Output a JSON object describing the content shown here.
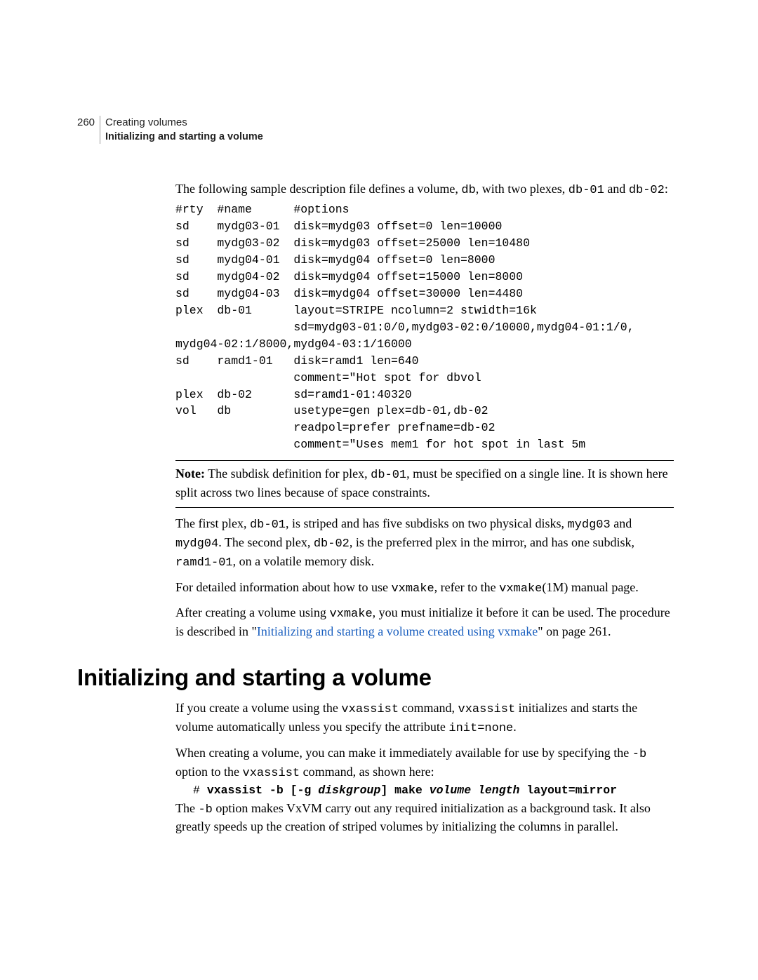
{
  "header": {
    "pagenum": "260",
    "chapter": "Creating volumes",
    "section": "Initializing and starting a volume"
  },
  "intro": {
    "pre": "The following sample description file defines a volume, ",
    "code1": "db",
    "mid1": ", with two plexes, ",
    "code2": "db-01",
    "mid2": " and ",
    "code3": "db-02",
    "end": ":"
  },
  "descfile": "#rty  #name      #options\nsd    mydg03-01  disk=mydg03 offset=0 len=10000\nsd    mydg03-02  disk=mydg03 offset=25000 len=10480\nsd    mydg04-01  disk=mydg04 offset=0 len=8000\nsd    mydg04-02  disk=mydg04 offset=15000 len=8000\nsd    mydg04-03  disk=mydg04 offset=30000 len=4480\nplex  db-01      layout=STRIPE ncolumn=2 stwidth=16k\n                 sd=mydg03-01:0/0,mydg03-02:0/10000,mydg04-01:1/0,\nmydg04-02:1/8000,mydg04-03:1/16000\nsd    ramd1-01   disk=ramd1 len=640\n                 comment=\"Hot spot for dbvol\nplex  db-02      sd=ramd1-01:40320\nvol   db         usetype=gen plex=db-01,db-02\n                 readpol=prefer prefname=db-02\n                 comment=\"Uses mem1 for hot spot in last 5m",
  "note": {
    "label": "Note:",
    "t1": " The subdisk definition for plex, ",
    "c1": "db-01",
    "t2": ", must be specified on a single line. It is shown here split across two lines because of space constraints."
  },
  "p1": {
    "t1": "The first plex, ",
    "c1": "db-01",
    "t2": ", is striped and has five subdisks on two physical disks, ",
    "c2": "mydg03",
    "t3": " and ",
    "c3": "mydg04",
    "t4": ". The second plex, ",
    "c4": "db-02",
    "t5": ", is the preferred plex in the mirror, and has one subdisk, ",
    "c5": "ramd1-01",
    "t6": ", on a volatile memory disk."
  },
  "p2": {
    "t1": "For detailed information about how to use ",
    "c1": "vxmake",
    "t2": ", refer to the ",
    "c2": "vxmake",
    "t3": "(1M) manual page."
  },
  "p3": {
    "t1": "After creating a volume using ",
    "c1": "vxmake",
    "t2": ", you must initialize it before it can be used. The procedure is described in \"",
    "link": "Initializing and starting a volume created using vxmake",
    "t3": "\" on page 261."
  },
  "heading": "Initializing and starting a volume",
  "p4": {
    "t1": "If you create a volume using the ",
    "c1": "vxassist",
    "t2": " command, ",
    "c2": "vxassist",
    "t3": " initializes and starts the volume automatically unless you specify the attribute ",
    "c3": "init=none",
    "t4": "."
  },
  "p5": {
    "t1": "When creating a volume, you can make it immediately available for use by specifying the ",
    "c1": "-b",
    "t2": " option to the ",
    "c2": "vxassist",
    "t3": " command, as shown here:"
  },
  "cmd": {
    "a": "# ",
    "b": "vxassist -b [-g ",
    "c": "diskgroup",
    "d": "] make ",
    "e": "volume length",
    "f": " layout=mirror"
  },
  "p6": {
    "t1": "The ",
    "c1": "-b",
    "t2": " option makes VxVM carry out any required initialization as a background task. It also greatly speeds up the creation of striped volumes by initializing the columns in parallel."
  }
}
